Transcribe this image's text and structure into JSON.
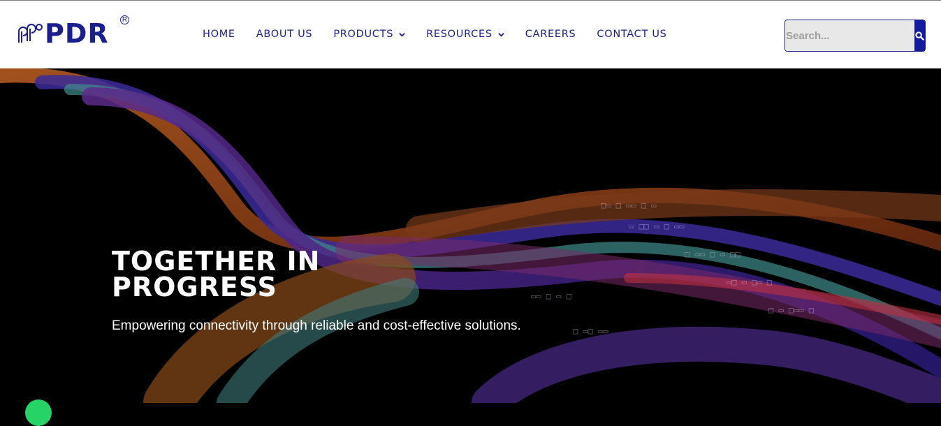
{
  "brand": {
    "name": "PDR",
    "registered": "R"
  },
  "nav": {
    "items": [
      {
        "label": "HOME",
        "has_dropdown": false
      },
      {
        "label": "ABOUT US",
        "has_dropdown": false
      },
      {
        "label": "PRODUCTS",
        "has_dropdown": true
      },
      {
        "label": "RESOURCES",
        "has_dropdown": true
      },
      {
        "label": "CAREERS",
        "has_dropdown": false
      },
      {
        "label": "CONTACT US",
        "has_dropdown": false
      }
    ]
  },
  "search": {
    "placeholder": "Search...",
    "value": ""
  },
  "hero": {
    "title": "TOGETHER IN PROGRESS",
    "subtitle": "Empowering connectivity through reliable and cost-effective solutions."
  },
  "colors": {
    "brand": "#1a1f8f",
    "search_button": "#141b9e",
    "header_bg": "#ffffff",
    "hero_bg": "#000000",
    "chat": "#25d366"
  },
  "icons": {
    "search": "search-icon",
    "dropdown": "chevron-down-icon",
    "chat": "whatsapp-icon"
  }
}
